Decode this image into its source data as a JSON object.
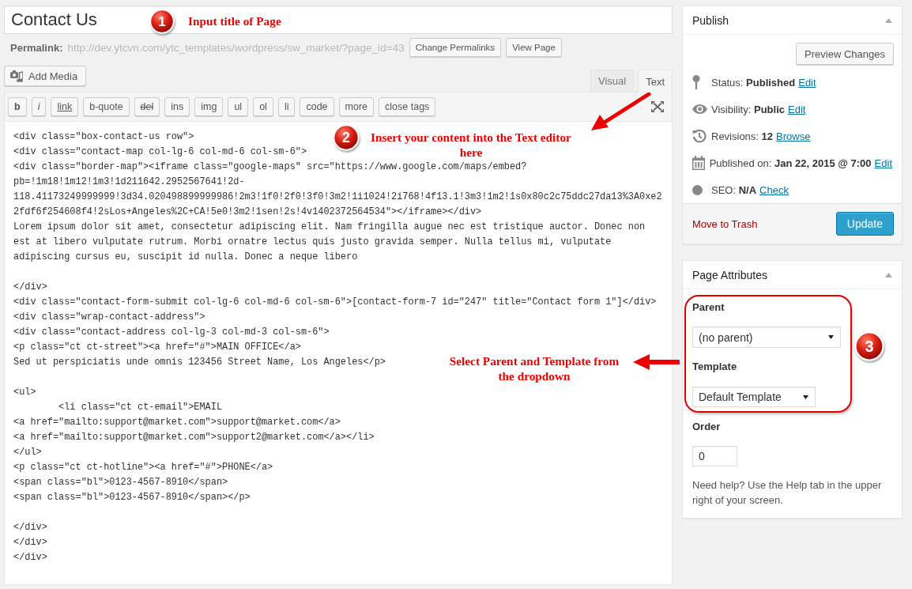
{
  "title_field": {
    "value": "Contact Us"
  },
  "permalink": {
    "label": "Permalink:",
    "url": "http://dev.ytcvn.com/ytc_templates/wordpress/sw_market/?page_id=43",
    "buttons": [
      "Change Permalinks",
      "View Page"
    ]
  },
  "add_media": {
    "label": "Add Media"
  },
  "editor_tabs": [
    {
      "label": "Visual",
      "selected": false
    },
    {
      "label": "Text",
      "selected": true
    }
  ],
  "toolbar": [
    {
      "label": "b",
      "kind": "bold"
    },
    {
      "label": "i",
      "kind": "italic"
    },
    {
      "label": "link",
      "kind": "underline"
    },
    {
      "label": "b-quote",
      "kind": "plain"
    },
    {
      "label": "del",
      "kind": "strike"
    },
    {
      "label": "ins",
      "kind": "plain"
    },
    {
      "label": "img",
      "kind": "plain"
    },
    {
      "label": "ul",
      "kind": "plain"
    },
    {
      "label": "ol",
      "kind": "plain"
    },
    {
      "label": "li",
      "kind": "plain"
    },
    {
      "label": "code",
      "kind": "plain"
    },
    {
      "label": "more",
      "kind": "plain"
    },
    {
      "label": "close tags",
      "kind": "plain"
    }
  ],
  "editor": {
    "blocks": [
      [
        "<div class=\"box-contact-us row\">",
        "<div class=\"contact-map col-lg-6 col-md-6 col-sm-6\">",
        "<div class=\"border-map\"><iframe class=\"google-maps\" src=\"https://www.google.com/maps/embed?",
        "pb=!1m18!1m12!1m3!1d211642.2952567641!2d-",
        "118.41173249999999!3d34.020498899999986!2m3!1f0!2f0!3f0!3m2!1i1024!2i768!4f13.1!3m3!1m2!1s0x80c2c75ddc27da13%3A0xe2",
        "2fdf6f254608f4!2sLos+Angeles%2C+CA!5e0!3m2!1sen!2s!4v1402372564534\"></iframe></div>",
        "Lorem ipsum dolor sit amet, consectetur adipiscing elit. Nam fringilla augue nec est tristique auctor. Donec non",
        "est at libero vulputate rutrum. Morbi ornatre lectus quis justo gravida semper. Nulla tellus mi, vulputate",
        "adipiscing cursus eu, suscipit id nulla. Donec a neque libero"
      ],
      [
        "</div>",
        "<div class=\"contact-form-submit col-lg-6 col-md-6 col-sm-6\">[contact-form-7 id=\"247\" title=\"Contact form 1\"]</div>",
        "<div class=\"wrap-contact-address\">",
        "<div class=\"contact-address col-lg-3 col-md-3 col-sm-6\">",
        "<p class=\"ct ct-street\"><a href=\"#\">MAIN OFFICE</a>",
        "Sed ut perspiciatis unde omnis 123456 Street Name, Los Angeles</p>"
      ],
      [
        "<ul>",
        "\t<li class=\"ct ct-email\">EMAIL",
        "<a href=\"mailto:support@market.com\">support@market.com</a>",
        "<a href=\"mailto:support@market.com\">support2@market.com</a></li>",
        "</ul>",
        "<p class=\"ct ct-hotline\"><a href=\"#\">PHONE</a>",
        "<span class=\"bl\">0123-4567-8910</span>",
        "<span class=\"bl\">0123-4567-8910</span></p>"
      ],
      [
        "</div>",
        "</div>",
        "</div>"
      ]
    ]
  },
  "publish": {
    "title": "Publish",
    "preview_button": "Preview Changes",
    "rows": [
      {
        "kind": "status",
        "label": "Status:",
        "value": "Published",
        "link": "Edit"
      },
      {
        "kind": "visibility",
        "label": "Visibility:",
        "value": "Public",
        "link": "Edit"
      },
      {
        "kind": "revisions",
        "label": "Revisions:",
        "value": "12",
        "link": "Browse"
      },
      {
        "kind": "date",
        "label": "Published on:",
        "value": "Jan 22, 2015 @ 7:00",
        "link": "Edit"
      },
      {
        "kind": "seo",
        "label": "SEO:",
        "value": "N/A",
        "link": "Check"
      }
    ],
    "trash": "Move to Trash",
    "update_button": "Update"
  },
  "page_attributes": {
    "title": "Page Attributes",
    "parent": {
      "label": "Parent",
      "value": "(no parent)"
    },
    "template": {
      "label": "Template",
      "value": "Default Template"
    },
    "order": {
      "label": "Order",
      "value": "0"
    },
    "help": "Need help? Use the Help tab in the upper right of your screen."
  },
  "annotations": [
    {
      "number": "1",
      "text": "Input title of Page"
    },
    {
      "number": "2",
      "text": "Insert your content into the Text editor here"
    },
    {
      "number": "3",
      "text": "Select Parent and Template from the dropdown"
    }
  ]
}
